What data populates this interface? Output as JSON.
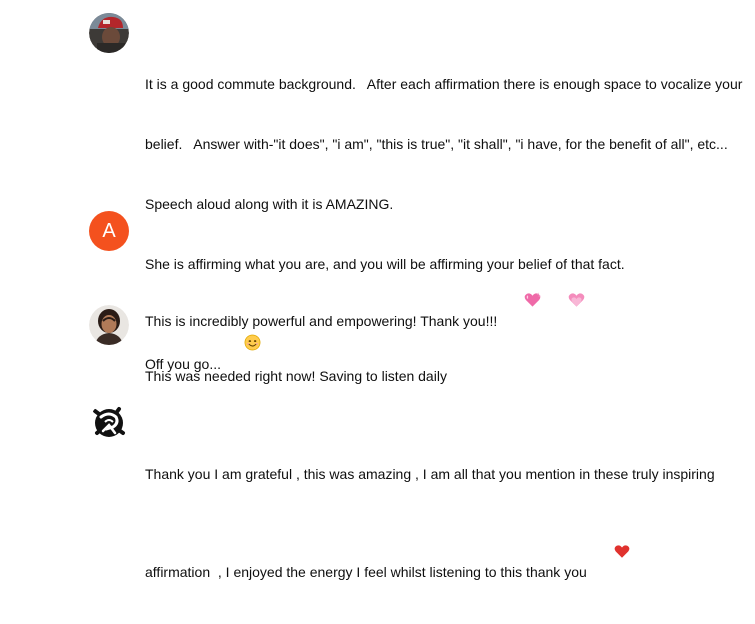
{
  "comments": [
    {
      "avatar_icon": "user-photo-avatar",
      "lines": [
        "It is a good commute background.   After each affirmation there is enough space to vocalize your",
        "belief.   Answer with-\"it does\", \"i am\", \"this is true\", \"it shall\", \"i have, for the benefit of all\", etc...",
        "Speech aloud along with it is AMAZING.",
        "She is affirming what you are, and you will be affirming your belief of that fact.",
        "Off you go..."
      ],
      "emoji": "smiling-face-emoji"
    },
    {
      "avatar_letter": "A",
      "avatar_color": "#f4511e",
      "text": "This is incredibly powerful and empowering! Thank you!!! ",
      "emoji": "pink-hearts-emoji"
    },
    {
      "avatar_icon": "user-photo-avatar",
      "text": "This was needed right now! Saving to listen daily"
    },
    {
      "avatar_icon": "logo-avatar",
      "lines": [
        "Thank you I am grateful , this was amazing , I am all that you mention in these truly inspiring",
        "affirmation  , I enjoyed the energy I feel whilst listening to this thank you "
      ],
      "emoji": "red-heart-emoji"
    }
  ]
}
